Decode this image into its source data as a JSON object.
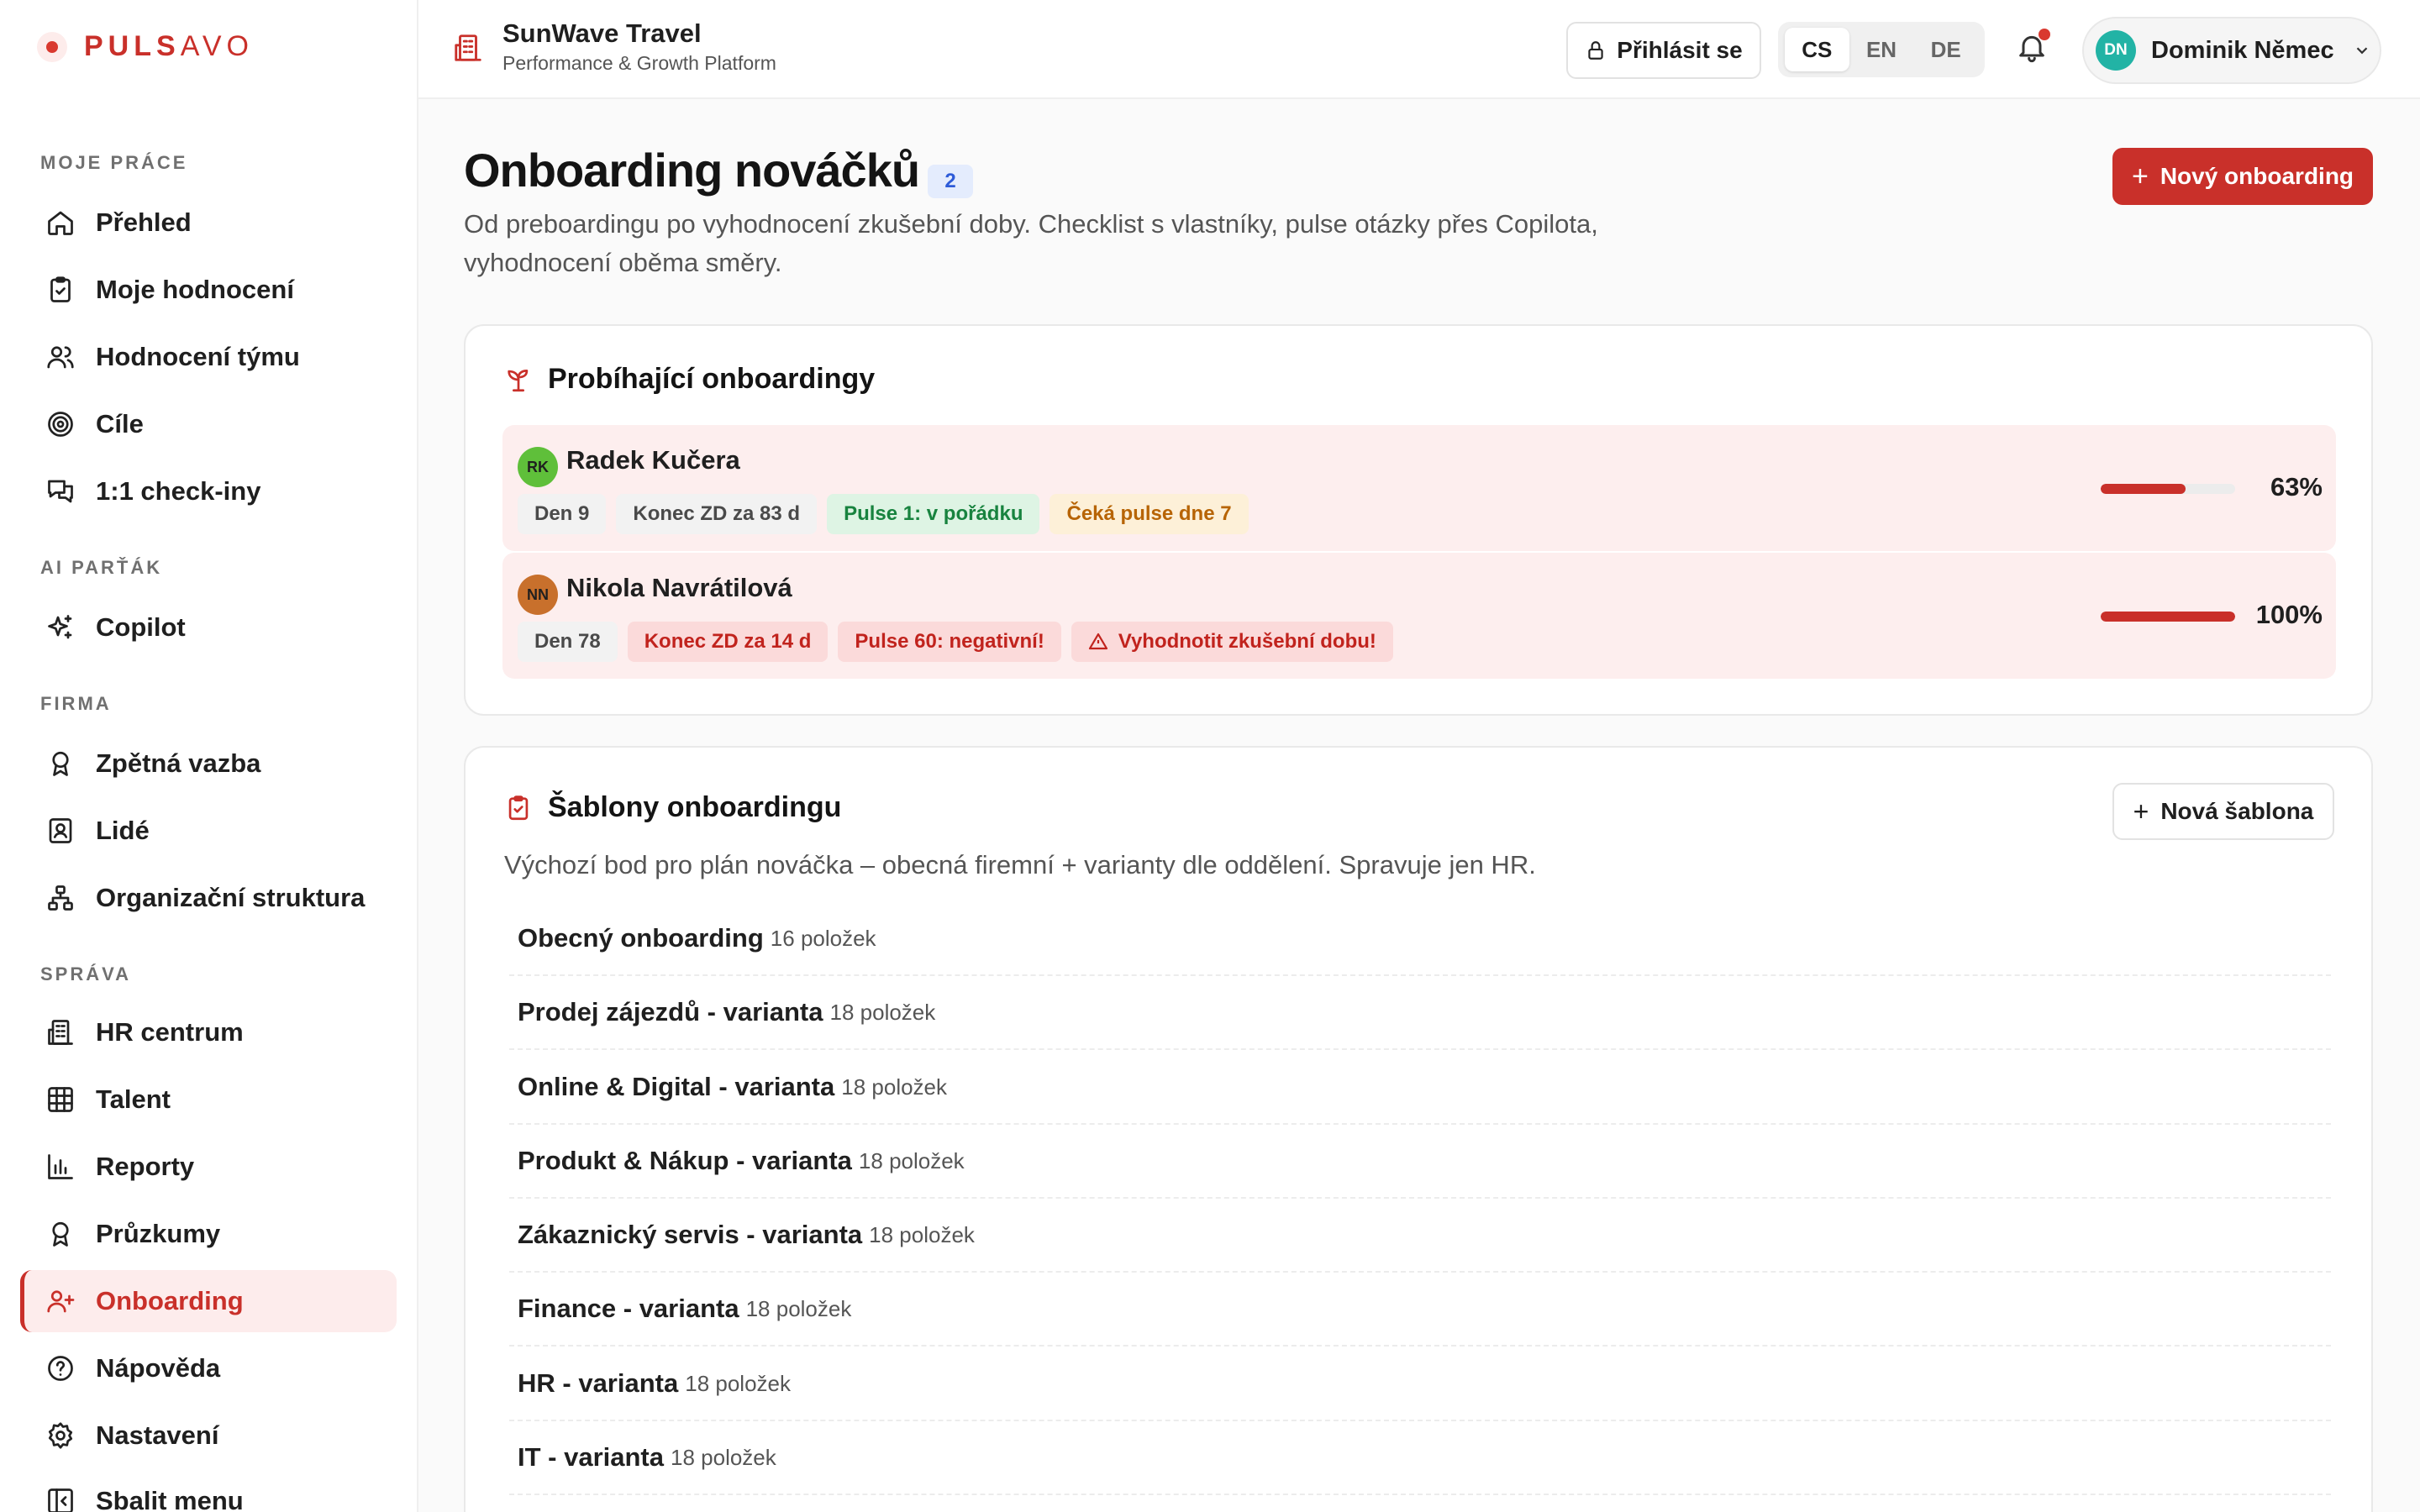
{
  "brand": {
    "logo_bold": "PULS",
    "logo_light": "AVO"
  },
  "sidebar": {
    "sections": [
      "MOJE PRÁCE",
      "AI PARŤÁK",
      "FIRMA",
      "SPRÁVA"
    ],
    "items": [
      {
        "label": "Přehled",
        "icon": "home-icon"
      },
      {
        "label": "Moje hodnocení",
        "icon": "clipboard-check-icon"
      },
      {
        "label": "Hodnocení týmu",
        "icon": "users-icon"
      },
      {
        "label": "Cíle",
        "icon": "target-icon"
      },
      {
        "label": "1:1 check-iny",
        "icon": "chat-icon"
      },
      {
        "label": "Copilot",
        "icon": "sparkles-icon"
      },
      {
        "label": "Zpětná vazba",
        "icon": "award-icon"
      },
      {
        "label": "Lidé",
        "icon": "contact-icon"
      },
      {
        "label": "Organizační struktura",
        "icon": "org-chart-icon"
      },
      {
        "label": "HR centrum",
        "icon": "building-icon"
      },
      {
        "label": "Talent",
        "icon": "grid-icon"
      },
      {
        "label": "Reporty",
        "icon": "bar-chart-icon"
      },
      {
        "label": "Průzkumy",
        "icon": "award-icon"
      },
      {
        "label": "Onboarding",
        "icon": "user-plus-icon",
        "active": true
      },
      {
        "label": "Nápověda",
        "icon": "help-icon"
      },
      {
        "label": "Nastavení",
        "icon": "gear-icon"
      },
      {
        "label": "Sbalit menu",
        "icon": "collapse-icon"
      }
    ]
  },
  "topbar": {
    "org_name": "SunWave Travel",
    "org_subtitle": "Performance & Growth Platform",
    "login_label": "Přihlásit se",
    "languages": [
      "CS",
      "EN",
      "DE"
    ],
    "selected_language": "CS",
    "user_initials": "DN",
    "user_name": "Dominik Němec"
  },
  "page": {
    "title": "Onboarding nováčků",
    "count": "2",
    "description": "Od preboardingu po vyhodnocení zkušební doby. Checklist s vlastníky, pulse otázky přes Copilota, vyhodnocení oběma směry.",
    "new_button": "Nový onboarding"
  },
  "ongoing": {
    "title": "Probíhající onboardingy",
    "rows": [
      {
        "initials": "RK",
        "name": "Radek Kučera",
        "avatar_color": "#5fbf3a",
        "chips": [
          {
            "text": "Den 9",
            "style": "neutral"
          },
          {
            "text": "Konec ZD za 83 d",
            "style": "neutral"
          },
          {
            "text": "Pulse 1: v pořádku",
            "style": "green"
          },
          {
            "text": "Čeká pulse dne 7",
            "style": "amber"
          }
        ],
        "progress": 63,
        "progress_label": "63%"
      },
      {
        "initials": "NN",
        "name": "Nikola Navrátilová",
        "avatar_color": "#c8702c",
        "chips": [
          {
            "text": "Den 78",
            "style": "neutral"
          },
          {
            "text": "Konec ZD za 14 d",
            "style": "red"
          },
          {
            "text": "Pulse 60: negativní!",
            "style": "red"
          },
          {
            "text": "Vyhodnotit zkušební dobu!",
            "style": "red",
            "icon": "warning-icon"
          }
        ],
        "progress": 100,
        "progress_label": "100%"
      }
    ]
  },
  "templates": {
    "title": "Šablony onboardingu",
    "new_button": "Nová šablona",
    "description": "Výchozí bod pro plán nováčka – obecná firemní + varianty dle oddělení. Spravuje jen HR.",
    "items": [
      {
        "name": "Obecný onboarding",
        "count": "16 položek"
      },
      {
        "name": "Prodej zájezdů - varianta",
        "count": "18 položek"
      },
      {
        "name": "Online & Digital - varianta",
        "count": "18 položek"
      },
      {
        "name": "Produkt & Nákup - varianta",
        "count": "18 položek"
      },
      {
        "name": "Zákaznický servis - varianta",
        "count": "18 položek"
      },
      {
        "name": "Finance - varianta",
        "count": "18 položek"
      },
      {
        "name": "HR - varianta",
        "count": "18 položek"
      },
      {
        "name": "IT - varianta",
        "count": "18 položek"
      }
    ]
  },
  "colors": {
    "accent": "#c9302a",
    "accent_bg": "#fdecec",
    "user_avatar": "#22b3a5"
  }
}
